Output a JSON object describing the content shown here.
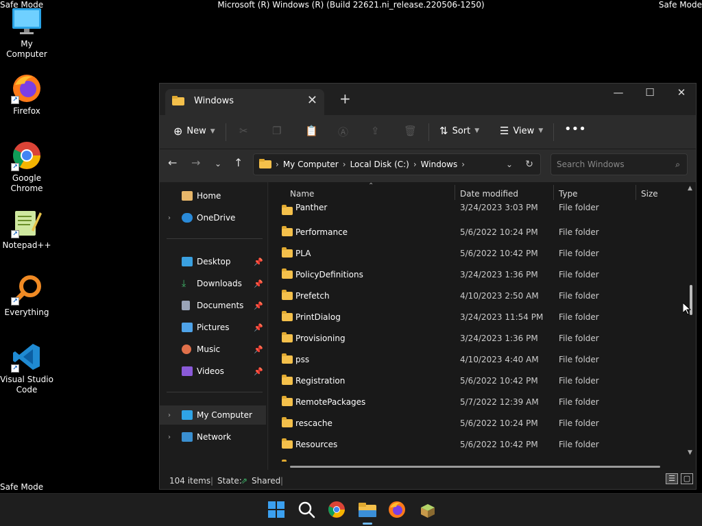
{
  "screen": {
    "safe_mode_label": "Safe Mode",
    "os_title": "Microsoft (R) Windows (R) (Build 22621.ni_release.220506-1250)"
  },
  "desktop": {
    "icons": [
      {
        "label": "My Computer",
        "icon": "computer-icon"
      },
      {
        "label": "Firefox",
        "icon": "firefox-icon"
      },
      {
        "label": "Google Chrome",
        "icon": "chrome-icon"
      },
      {
        "label": "Notepad++",
        "icon": "notepadpp-icon"
      },
      {
        "label": "Everything",
        "icon": "everything-search-icon"
      },
      {
        "label": "Visual Studio Code",
        "icon": "vscode-icon"
      }
    ]
  },
  "window": {
    "tab_title": "Windows",
    "toolbar": {
      "new_label": "New",
      "sort_label": "Sort",
      "view_label": "View"
    },
    "address": {
      "crumbs": [
        "My Computer",
        "Local Disk (C:)",
        "Windows"
      ]
    },
    "search": {
      "placeholder": "Search Windows"
    },
    "nav": {
      "home": "Home",
      "onedrive": "OneDrive",
      "desktop": "Desktop",
      "downloads": "Downloads",
      "documents": "Documents",
      "pictures": "Pictures",
      "music": "Music",
      "videos": "Videos",
      "my_computer": "My Computer",
      "network": "Network"
    },
    "columns": {
      "name": "Name",
      "date": "Date modified",
      "type": "Type",
      "size": "Size"
    },
    "files": [
      {
        "name": "Panther",
        "date": "3/24/2023 3:03 PM",
        "type": "File folder"
      },
      {
        "name": "Performance",
        "date": "5/6/2022 10:24 PM",
        "type": "File folder"
      },
      {
        "name": "PLA",
        "date": "5/6/2022 10:42 PM",
        "type": "File folder"
      },
      {
        "name": "PolicyDefinitions",
        "date": "3/24/2023 1:36 PM",
        "type": "File folder"
      },
      {
        "name": "Prefetch",
        "date": "4/10/2023 2:50 AM",
        "type": "File folder"
      },
      {
        "name": "PrintDialog",
        "date": "3/24/2023 11:54 PM",
        "type": "File folder"
      },
      {
        "name": "Provisioning",
        "date": "3/24/2023 1:36 PM",
        "type": "File folder"
      },
      {
        "name": "pss",
        "date": "4/10/2023 4:40 AM",
        "type": "File folder"
      },
      {
        "name": "Registration",
        "date": "5/6/2022 10:42 PM",
        "type": "File folder"
      },
      {
        "name": "RemotePackages",
        "date": "5/7/2022 12:39 AM",
        "type": "File folder"
      },
      {
        "name": "rescache",
        "date": "5/6/2022 10:24 PM",
        "type": "File folder"
      },
      {
        "name": "Resources",
        "date": "5/6/2022 10:42 PM",
        "type": "File folder"
      }
    ],
    "status": {
      "count": "104 items",
      "state_label": "State:",
      "state_value": "Shared"
    }
  },
  "taskbar": {
    "items": [
      "windows-start-icon",
      "search-icon",
      "chrome-icon",
      "file-explorer-icon",
      "firefox-icon",
      "app-icon"
    ]
  }
}
